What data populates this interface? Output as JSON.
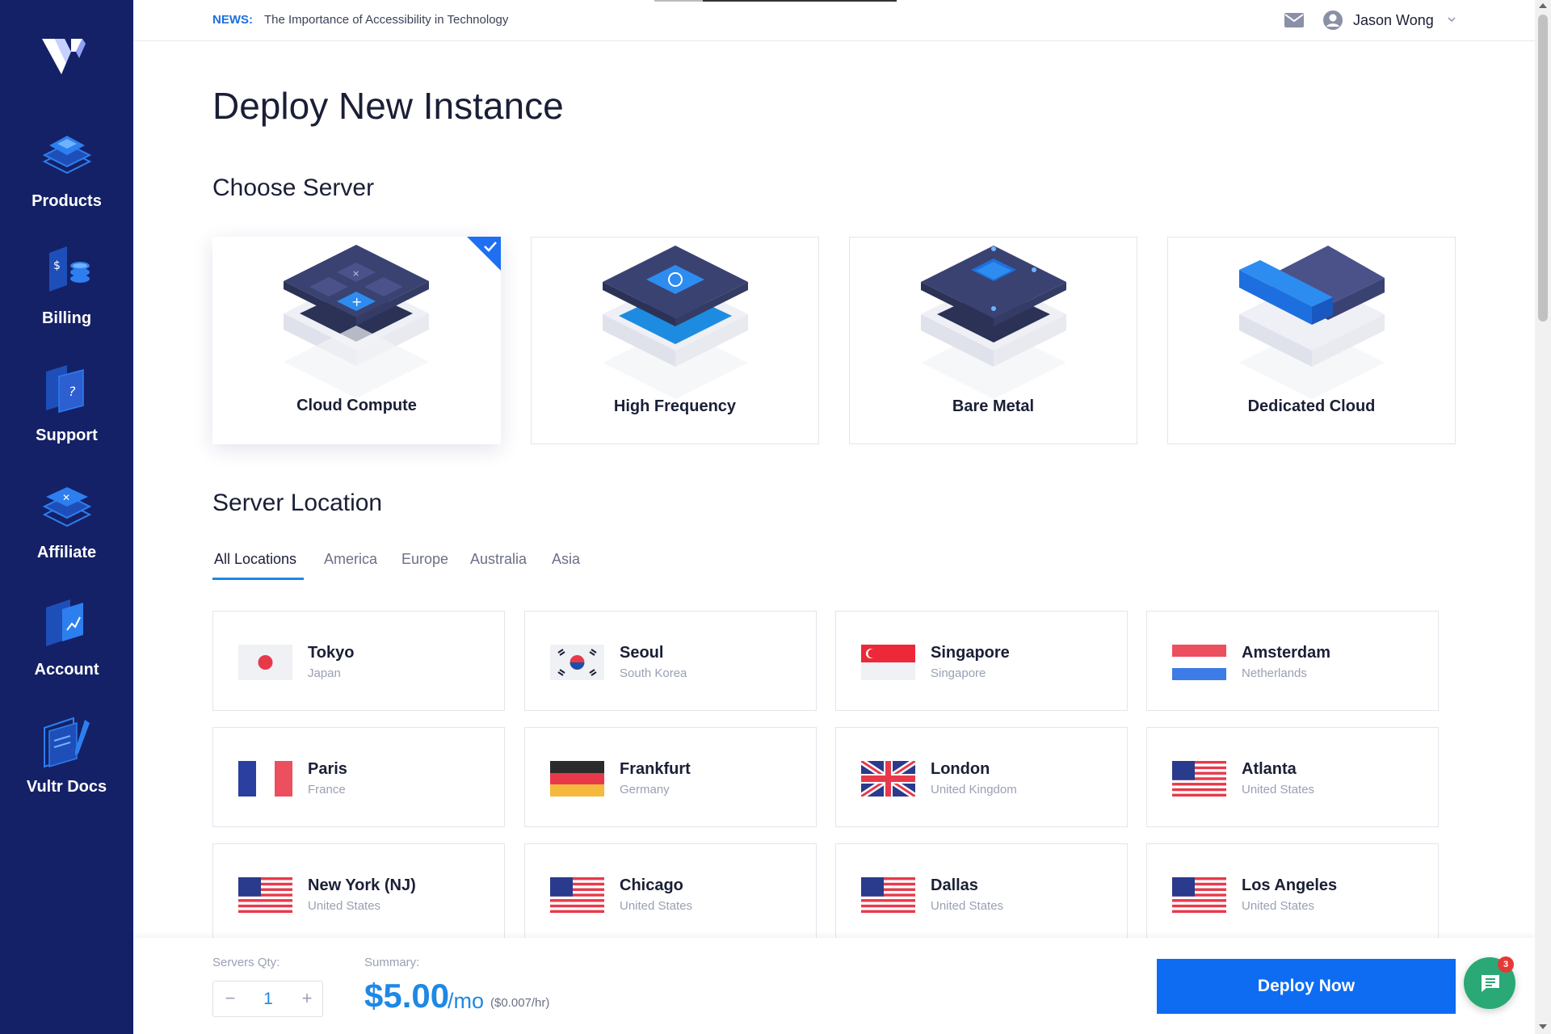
{
  "topbar": {
    "news_tag": "NEWS:",
    "news_text": "The Importance of Accessibility in Technology",
    "user_name": "Jason Wong"
  },
  "sidebar": {
    "items": [
      {
        "label": "Products",
        "icon": "products-icon"
      },
      {
        "label": "Billing",
        "icon": "billing-icon"
      },
      {
        "label": "Support",
        "icon": "support-icon"
      },
      {
        "label": "Affiliate",
        "icon": "affiliate-icon"
      },
      {
        "label": "Account",
        "icon": "account-icon"
      },
      {
        "label": "Vultr Docs",
        "icon": "docs-icon"
      }
    ]
  },
  "main": {
    "page_title": "Deploy New Instance",
    "choose_server_title": "Choose Server",
    "servers": [
      {
        "label": "Cloud Compute",
        "selected": true
      },
      {
        "label": "High Frequency",
        "selected": false
      },
      {
        "label": "Bare Metal",
        "selected": false
      },
      {
        "label": "Dedicated Cloud",
        "selected": false
      }
    ],
    "server_location_title": "Server Location",
    "tabs": [
      {
        "label": "All Locations",
        "active": true
      },
      {
        "label": "America",
        "active": false
      },
      {
        "label": "Europe",
        "active": false
      },
      {
        "label": "Australia",
        "active": false
      },
      {
        "label": "Asia",
        "active": false
      }
    ],
    "locations": [
      {
        "city": "Tokyo",
        "country": "Japan",
        "flag": "japan-flag"
      },
      {
        "city": "Seoul",
        "country": "South Korea",
        "flag": "south-korea-flag"
      },
      {
        "city": "Singapore",
        "country": "Singapore",
        "flag": "singapore-flag"
      },
      {
        "city": "Amsterdam",
        "country": "Netherlands",
        "flag": "netherlands-flag"
      },
      {
        "city": "Paris",
        "country": "France",
        "flag": "france-flag"
      },
      {
        "city": "Frankfurt",
        "country": "Germany",
        "flag": "germany-flag"
      },
      {
        "city": "London",
        "country": "United Kingdom",
        "flag": "uk-flag"
      },
      {
        "city": "Atlanta",
        "country": "United States",
        "flag": "us-flag"
      },
      {
        "city": "New York (NJ)",
        "country": "United States",
        "flag": "us-flag"
      },
      {
        "city": "Chicago",
        "country": "United States",
        "flag": "us-flag"
      },
      {
        "city": "Dallas",
        "country": "United States",
        "flag": "us-flag"
      },
      {
        "city": "Los Angeles",
        "country": "United States",
        "flag": "us-flag"
      }
    ]
  },
  "bottombar": {
    "qty_label": "Servers Qty:",
    "qty_minus": "−",
    "qty_value": "1",
    "qty_plus": "+",
    "summary_label": "Summary:",
    "price": "$5.00",
    "price_unit": "/mo",
    "price_hourly": "($0.007/hr)",
    "deploy_label": "Deploy Now"
  },
  "chat": {
    "badge_count": "3"
  },
  "colors": {
    "sidebar_bg": "#142166",
    "accent": "#1e88e5",
    "deploy_button": "#0d6cf2",
    "chat_button": "#2aa876",
    "badge": "#e53935"
  }
}
